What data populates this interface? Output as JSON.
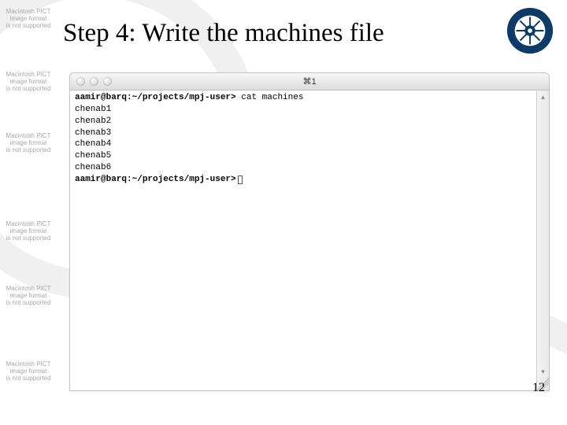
{
  "slide": {
    "title": "Step 4: Write the machines file",
    "page_number": "12"
  },
  "logo": {
    "ring_color": "#0d3a66",
    "center_color": "#ffffff"
  },
  "pict_placeholder": {
    "l1": "Macintosh PICT",
    "l2": "image format",
    "l3": "is not supported"
  },
  "terminal": {
    "title": "⌘1",
    "buttons": {
      "close": "close",
      "minimize": "minimize",
      "zoom": "zoom"
    },
    "scroll": {
      "up": "▴",
      "down": "▾"
    },
    "lines": [
      {
        "prompt": "aamir@barq:~/projects/mpj-user>",
        "cmd": " cat machines"
      },
      {
        "out": "chenab1"
      },
      {
        "out": "chenab2"
      },
      {
        "out": "chenab3"
      },
      {
        "out": "chenab4"
      },
      {
        "out": "chenab5"
      },
      {
        "out": "chenab6"
      },
      {
        "prompt": "aamir@barq:~/projects/mpj-user>",
        "cmd": "",
        "cursor": true
      }
    ]
  }
}
